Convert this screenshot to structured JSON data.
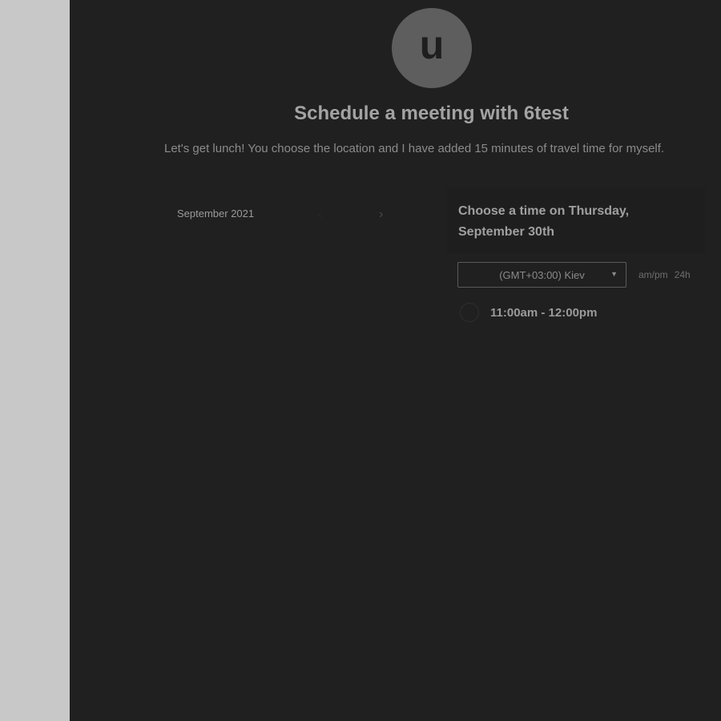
{
  "host": {
    "avatar_letter": "u",
    "title": "Schedule a meeting with 6test",
    "description": "Let's get lunch! You choose the location and I have added 15 minutes of travel time for myself."
  },
  "calendar": {
    "month_label": "September 2021",
    "prev_icon": "chevron-left-icon",
    "next_icon": "chevron-right-icon"
  },
  "times": {
    "heading_line1": "Choose a time on Thursday,",
    "heading_line2": "September 30th",
    "timezone_value": "(GMT+03:00) Kiev",
    "format_ampm": "am/pm",
    "format_24h": "24h",
    "slots": [
      "11:00am - 12:00pm"
    ]
  },
  "colors": {
    "overlay_background": "#202020",
    "side_background": "#c8c8c8"
  }
}
